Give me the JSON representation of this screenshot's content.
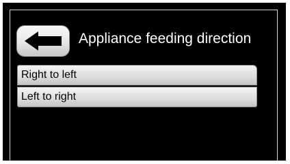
{
  "header": {
    "back_icon": "left-arrow-icon",
    "title": "Appliance feeding direction"
  },
  "menu": {
    "items": [
      {
        "label": "Right to left"
      },
      {
        "label": "Left to right"
      }
    ]
  },
  "colors": {
    "screen_background": "#000000",
    "frame": "#d8d8d8",
    "title_text": "#ffffff",
    "button_light": "#f4f4f4",
    "button_dark": "#c4c4c4"
  }
}
